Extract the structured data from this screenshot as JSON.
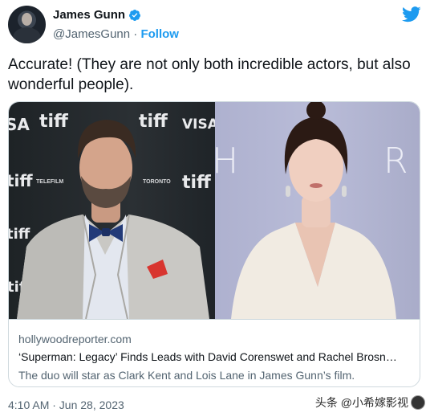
{
  "author": {
    "name": "James Gunn",
    "handle": "@JamesGunn",
    "separator": "·",
    "follow_label": "Follow"
  },
  "icons": {
    "verified": "verified-badge-icon",
    "platform": "twitter-bird-icon"
  },
  "tweet": {
    "text": "Accurate! (They are not only both incredible actors, but also wonderful people)."
  },
  "card": {
    "domain": "hollywoodreporter.com",
    "title": "‘Superman: Legacy’ Finds Leads with David Corenswet and Rachel Brosn…",
    "description": "The duo will star as Clark Kent and Lois Lane in James Gunn’s film.",
    "left_photo_backdrop": [
      "tiff",
      "tiff",
      "VISA",
      "tiff",
      "tiff",
      "TORONTO",
      "TELEFILM",
      "tiff",
      "SA",
      "tiff"
    ],
    "right_photo_backdrop": [
      "H",
      "R"
    ]
  },
  "timestamp": "4:10 AM · Jun 28, 2023",
  "watermark": {
    "text": "头条 @小希嫁影视"
  },
  "colors": {
    "accent": "#1d9bf0",
    "text_primary": "#0f1419",
    "text_secondary": "#536471",
    "border": "#cfd9de"
  }
}
